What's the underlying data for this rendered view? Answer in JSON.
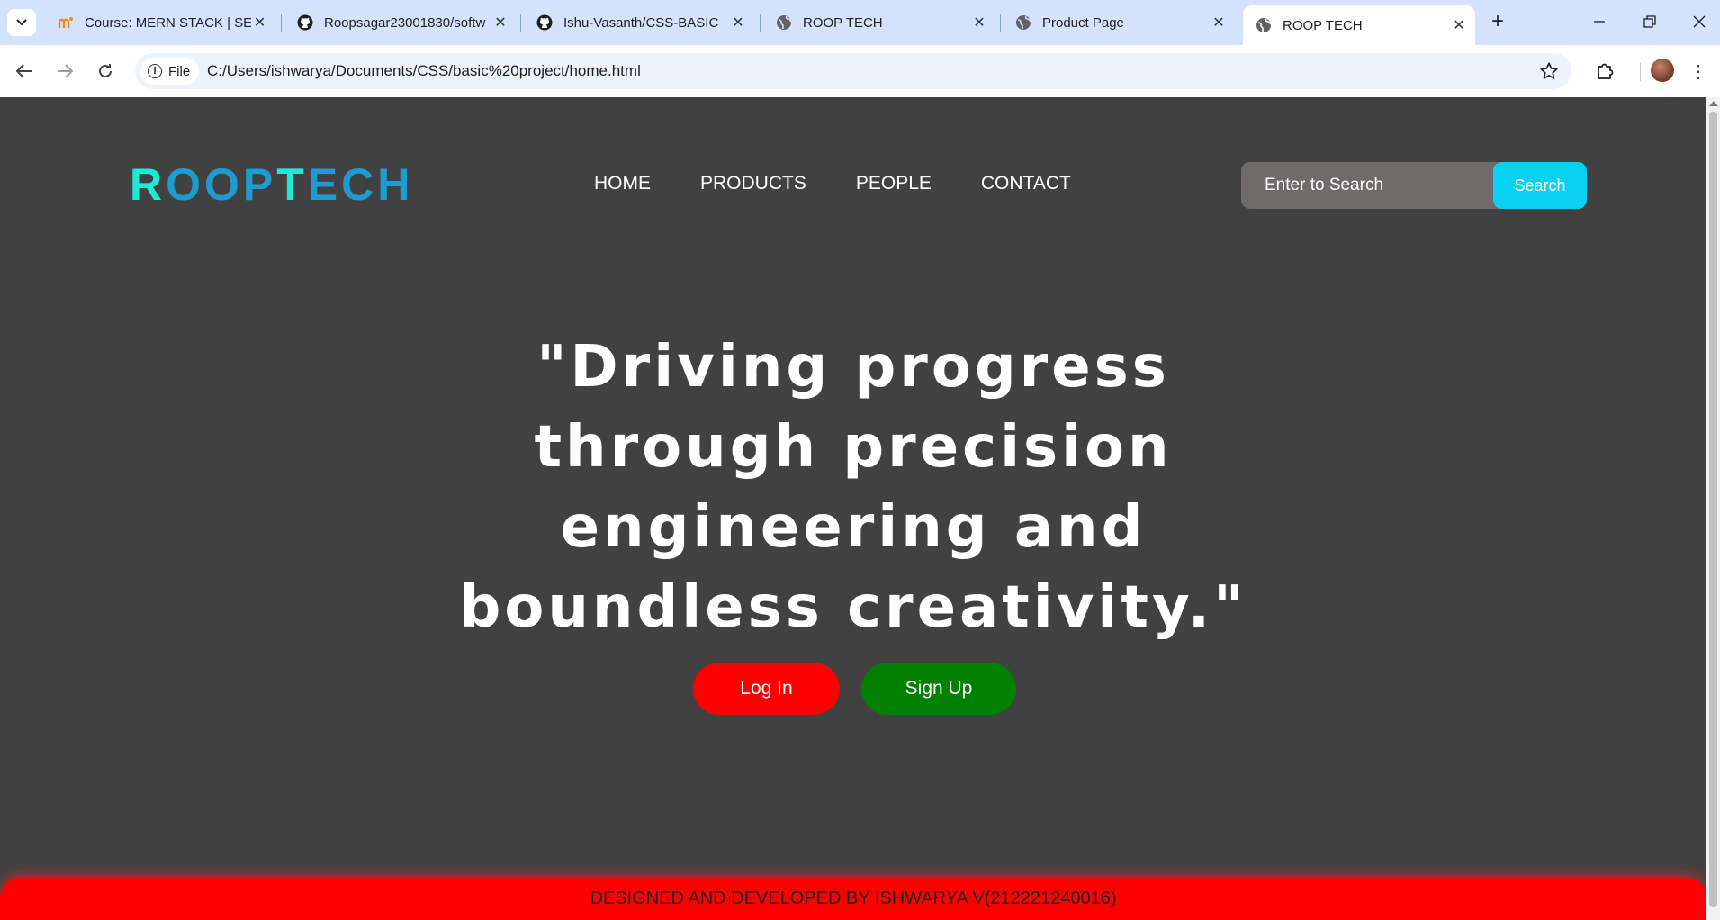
{
  "browser": {
    "tabs": [
      {
        "title": "Course: MERN STACK | SEC",
        "icon": "moodle-icon"
      },
      {
        "title": "Roopsagar23001830/softw",
        "icon": "github-icon"
      },
      {
        "title": "Ishu-Vasanth/CSS-BASIC",
        "icon": "github-icon"
      },
      {
        "title": "ROOP TECH",
        "icon": "globe-icon"
      },
      {
        "title": "Product Page",
        "icon": "globe-icon"
      },
      {
        "title": "ROOP TECH",
        "icon": "globe-icon",
        "active": true
      }
    ],
    "chip_label": "File",
    "url": "C:/Users/ishwarya/Documents/CSS/basic%20project/home.html"
  },
  "site": {
    "logo": {
      "part1": "R",
      "part2": "OOP",
      "part3": "T",
      "part4": "ECH"
    },
    "nav": [
      "HOME",
      "PRODUCTS",
      "PEOPLE",
      "CONTACT"
    ],
    "search": {
      "placeholder": "Enter to Search",
      "button": "Search"
    },
    "hero": {
      "line1": "\"Driving progress",
      "line2": "through precision",
      "line3": "engineering and",
      "line4": "boundless creativity.\""
    },
    "buttons": {
      "login": "Log In",
      "signup": "Sign Up"
    },
    "footer": "DESIGNED AND DEVELOPED BY ISHWARYA V(212221240016)"
  },
  "colors": {
    "page_bg": "#414141",
    "logo_cyan": "#1ee8d6",
    "logo_blue": "#1e9cd0",
    "search_button": "#0ad0f2",
    "login": "#fd0000",
    "signup": "#018001",
    "footer": "#fd0000"
  }
}
